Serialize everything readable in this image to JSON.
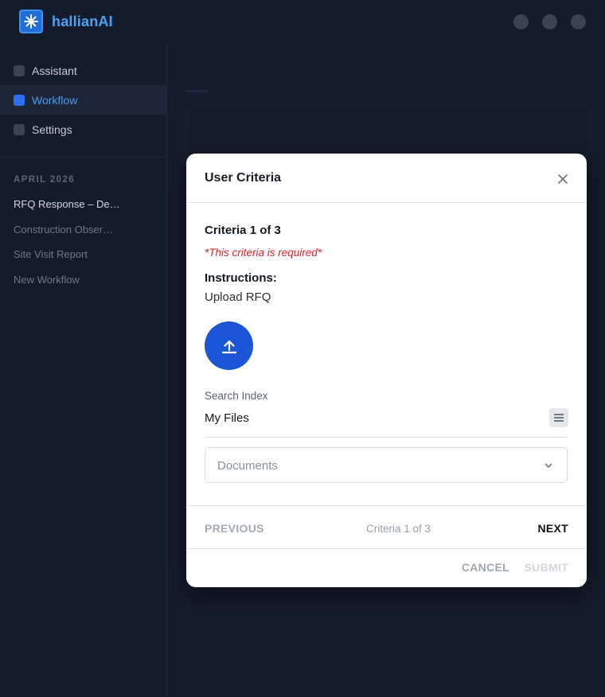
{
  "app": {
    "brand": "hallianAI",
    "logo_icon": "sparkle-icon",
    "accent_color": "#4aa3f5"
  },
  "header": {
    "actions": [
      "circle-button",
      "circle-button",
      "circle-button"
    ]
  },
  "sidebar": {
    "nav": [
      {
        "label": "Assistant",
        "active": false
      },
      {
        "label": "Workflow",
        "active": true
      },
      {
        "label": "Settings",
        "active": false
      }
    ],
    "section_title": "APRIL 2026",
    "recent": [
      "RFQ Response – De…",
      "Construction Obser…",
      "Site Visit Report",
      "New Workflow"
    ]
  },
  "modal": {
    "title": "User Criteria",
    "close_icon": "close-icon",
    "step_label": "Criteria 1 of 3",
    "required_text": "*This criteria is required*",
    "instructions_label": "Instructions:",
    "instructions_text": "Upload RFQ",
    "upload_icon": "upload-icon",
    "search_index_label": "Search Index",
    "search_index_value": "My Files",
    "documents_placeholder": "Documents",
    "previous_label": "PREVIOUS",
    "pager_text": "Criteria 1 of 3",
    "next_label": "NEXT",
    "cancel_label": "CANCEL",
    "submit_label": "SUBMIT",
    "primary_color": "#1c56d8",
    "required_color": "#d6272e"
  }
}
